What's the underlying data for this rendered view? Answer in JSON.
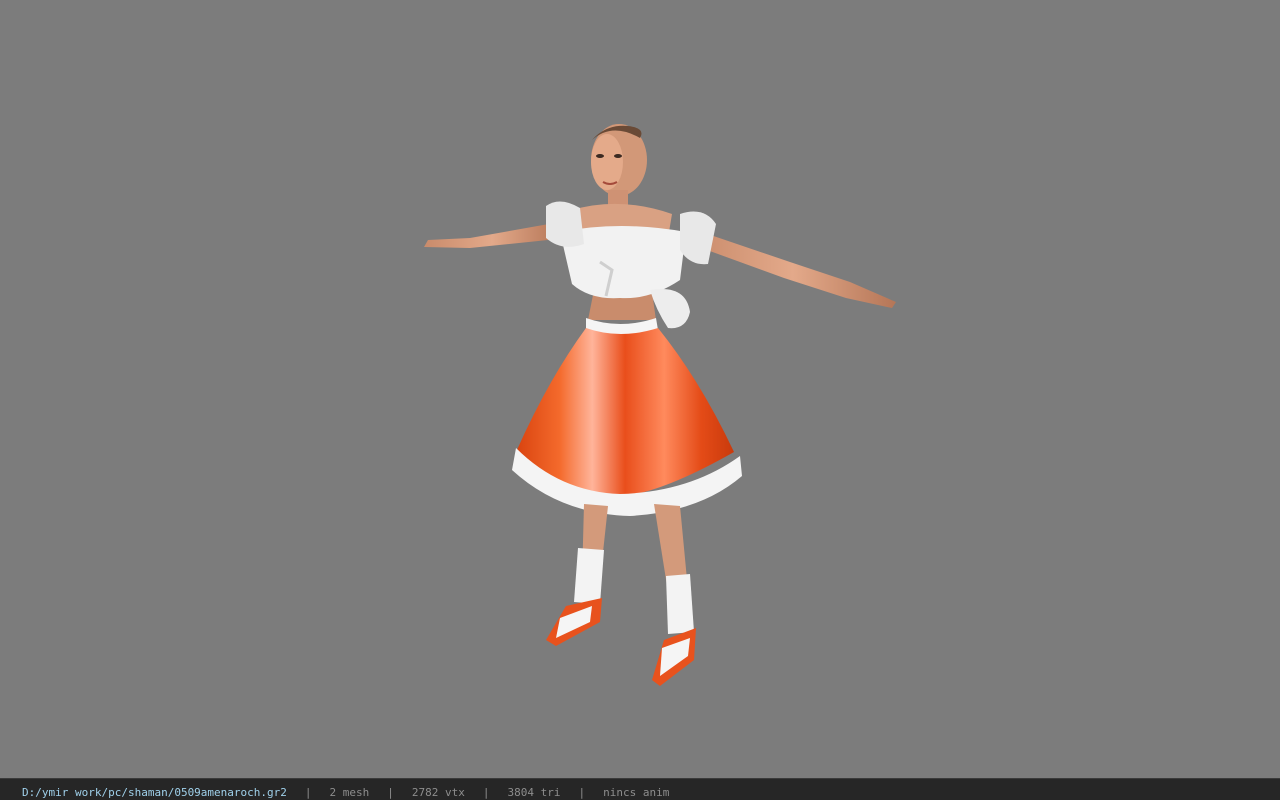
{
  "viewport": {
    "background_color": "#7c7c7c",
    "model": "character-model"
  },
  "statusbar": {
    "file_path": "D:/ymir work/pc/shaman/0509amenaroch.gr2",
    "separator": "|",
    "mesh_count": "2 mesh",
    "vertex_count": "2782 vtx",
    "triangle_count": "3804 tri",
    "anim_status": "nincs anim",
    "path_color": "#9fd0ea",
    "text_color": "#8d8d8d"
  }
}
